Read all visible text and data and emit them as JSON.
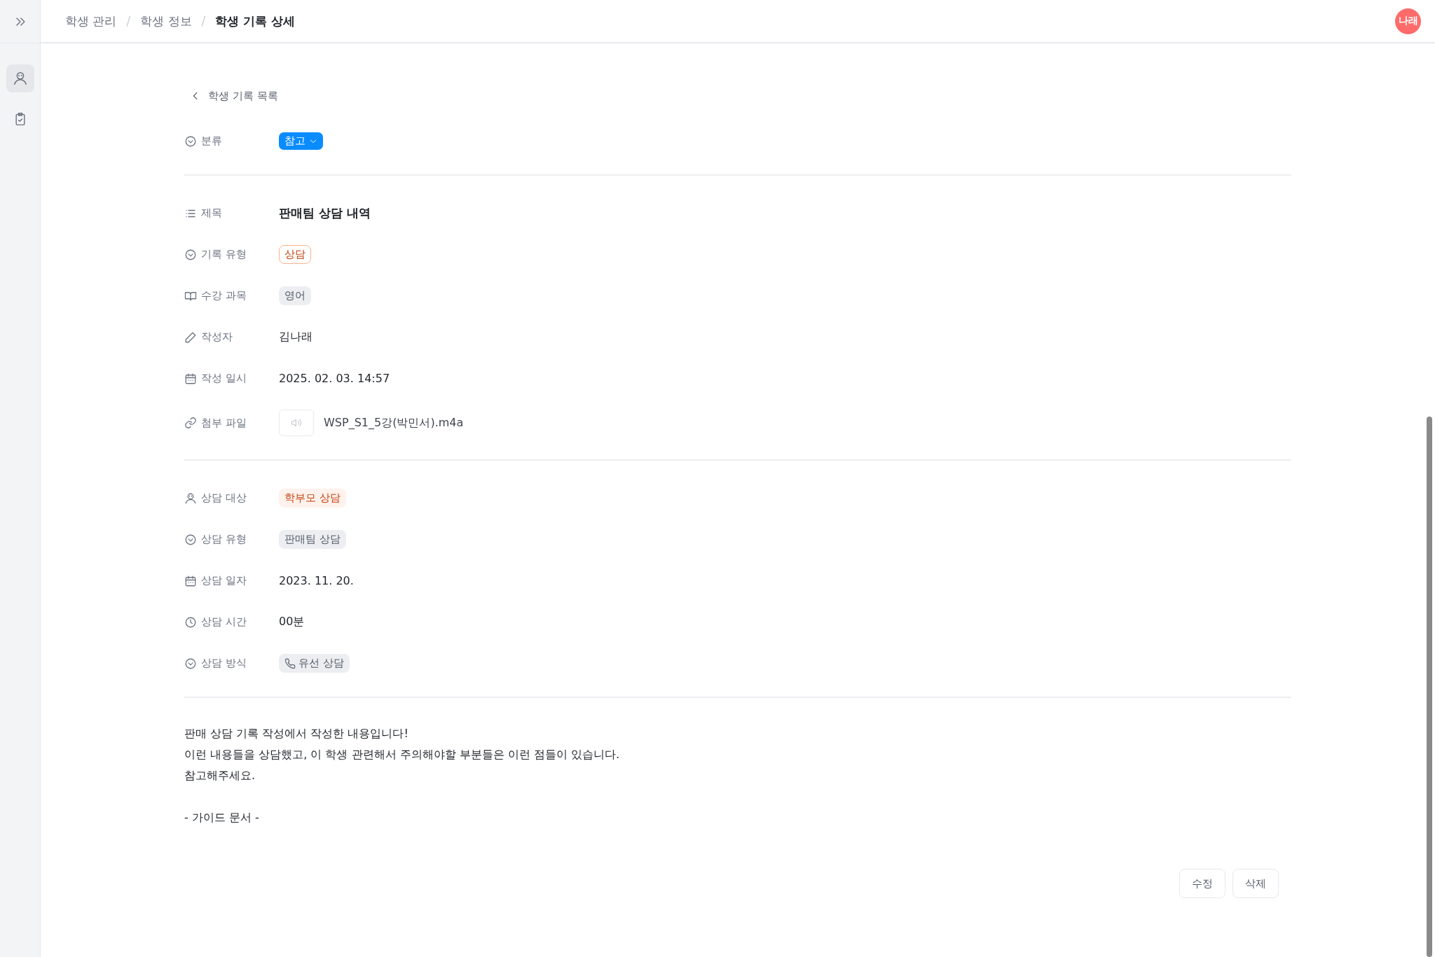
{
  "sidebar": {
    "items": [
      {
        "selected": true
      },
      {
        "selected": false
      }
    ]
  },
  "breadcrumb": [
    {
      "label": "학생 관리",
      "current": false
    },
    {
      "label": "학생 정보",
      "current": false
    },
    {
      "label": "학생 기록 상세",
      "current": true
    }
  ],
  "separator": "/",
  "avatar": {
    "initials": "나래",
    "color": "#ff6b6b"
  },
  "back_link": "학생 기록 목록",
  "category": {
    "label": "분류",
    "value": "참고"
  },
  "sections": [
    {
      "fields": [
        {
          "label": "제목",
          "kind": "heading",
          "value": "판매팀 상담 내역"
        },
        {
          "label": "기록 유형",
          "kind": "outline",
          "value": "상담"
        },
        {
          "label": "수강 과목",
          "kind": "gray",
          "value": "영어"
        },
        {
          "label": "작성자",
          "kind": "text",
          "value": "김나래"
        },
        {
          "label": "작성 일시",
          "kind": "text",
          "value": "2025. 02. 03. 14:57"
        },
        {
          "label": "첨부 파일",
          "kind": "file",
          "value": "WSP_S1_5강(박민서).m4a"
        }
      ]
    },
    {
      "fields": [
        {
          "label": "상담 대상",
          "kind": "soft",
          "value": "학부모 상담"
        },
        {
          "label": "상담 유형",
          "kind": "gray",
          "value": "판매팀 상담"
        },
        {
          "label": "상담 일자",
          "kind": "text",
          "value": "2023. 11. 20."
        },
        {
          "label": "상담 시간",
          "kind": "text",
          "value": "00분"
        },
        {
          "label": "상담 방식",
          "kind": "phone",
          "value": "유선 상담"
        }
      ]
    }
  ],
  "body": [
    [
      "판매 상담 기록 작성에서 작성한 내용입니다!",
      "이런 내용들을 상담했고, 이 학생 관련해서 주의해야할 부분들은 이런 점들이 있습니다.",
      "참고해주세요."
    ],
    [
      "- 가이드 문서 -"
    ]
  ],
  "buttons": [
    "수정",
    "삭제"
  ]
}
